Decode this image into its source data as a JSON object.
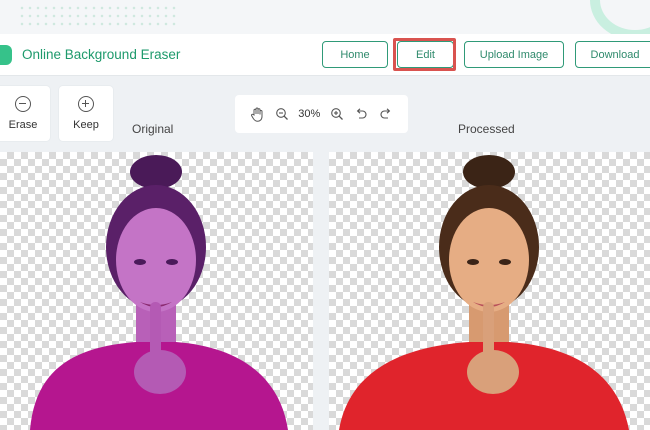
{
  "app": {
    "title": "Online Background Eraser"
  },
  "nav": {
    "home": "Home",
    "edit": "Edit",
    "upload": "Upload Image",
    "download": "Download"
  },
  "tools": {
    "erase": "Erase",
    "keep": "Keep"
  },
  "zoom": {
    "level": "30%"
  },
  "panels": {
    "original_label": "Original",
    "processed_label": "Processed"
  },
  "colors": {
    "accent": "#2f9a78",
    "highlight": "#d9534f",
    "erase_overlay": "#a020a8",
    "shirt_processed": "#e0242c"
  },
  "icons": [
    "hand-icon",
    "zoom-out-icon",
    "zoom-in-icon",
    "undo-icon",
    "redo-icon",
    "minus-circle-icon",
    "plus-circle-icon"
  ]
}
